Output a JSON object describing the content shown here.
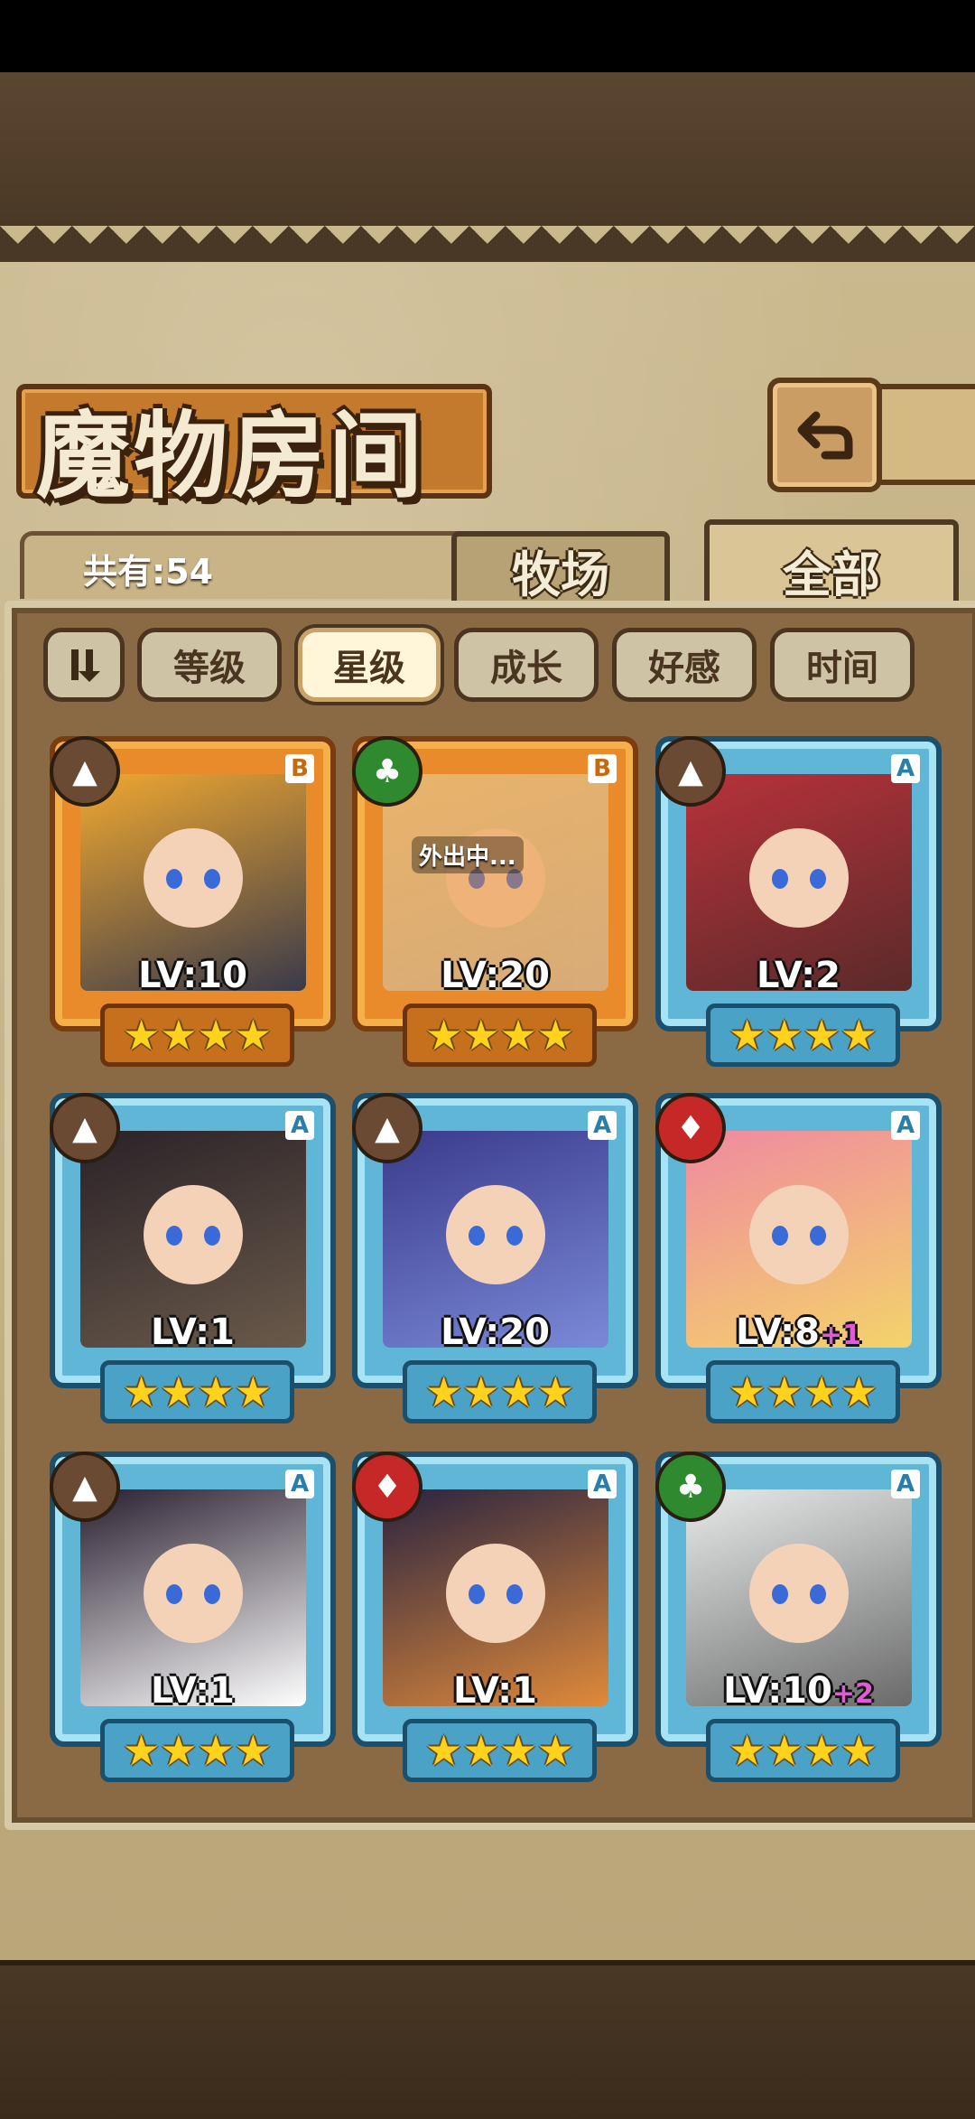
{
  "header": {
    "title": "魔物房间",
    "back_icon": "return-icon"
  },
  "summary": {
    "count_label": "共有:54"
  },
  "tabs": [
    {
      "label": "牧场",
      "active": false
    },
    {
      "label": "全部",
      "active": true
    }
  ],
  "filters": {
    "sort_icon": "sort-toggle-icon",
    "items": [
      {
        "label": "等级",
        "active": false
      },
      {
        "label": "星级",
        "active": true
      },
      {
        "label": "成长",
        "active": false
      },
      {
        "label": "好感",
        "active": false
      },
      {
        "label": "时间",
        "active": false
      }
    ]
  },
  "monsters": [
    {
      "rank": "B",
      "element": "earth",
      "level": "LV:10",
      "bonus": "",
      "stars": "★★★★",
      "status": "",
      "frame": "gold"
    },
    {
      "rank": "B",
      "element": "nature",
      "level": "LV:20",
      "bonus": "",
      "stars": "★★★★",
      "status": "外出中...",
      "frame": "gold"
    },
    {
      "rank": "A",
      "element": "earth",
      "level": "LV:2",
      "bonus": "",
      "stars": "★★★★",
      "status": "",
      "frame": "blue"
    },
    {
      "rank": "A",
      "element": "earth",
      "level": "LV:1",
      "bonus": "",
      "stars": "★★★★",
      "status": "",
      "frame": "blue"
    },
    {
      "rank": "A",
      "element": "earth",
      "level": "LV:20",
      "bonus": "",
      "stars": "★★★★",
      "status": "",
      "frame": "blue"
    },
    {
      "rank": "A",
      "element": "fire",
      "level": "LV:8",
      "bonus": "+1",
      "stars": "★★★★",
      "status": "",
      "frame": "blue"
    },
    {
      "rank": "A",
      "element": "earth",
      "level": "LV:1",
      "bonus": "",
      "stars": "★★★★",
      "status": "",
      "frame": "blue"
    },
    {
      "rank": "A",
      "element": "fire",
      "level": "LV:1",
      "bonus": "",
      "stars": "★★★★",
      "status": "",
      "frame": "blue"
    },
    {
      "rank": "A",
      "element": "nature",
      "level": "LV:10",
      "bonus": "+2",
      "stars": "★★★★",
      "status": "",
      "frame": "blue"
    }
  ],
  "colors": {
    "parchment": "#cbb98e",
    "gold_frame": "#e98b2a",
    "blue_frame": "#5fb6d6",
    "star": "#ffd21e",
    "bonus": "#e25bd6"
  }
}
